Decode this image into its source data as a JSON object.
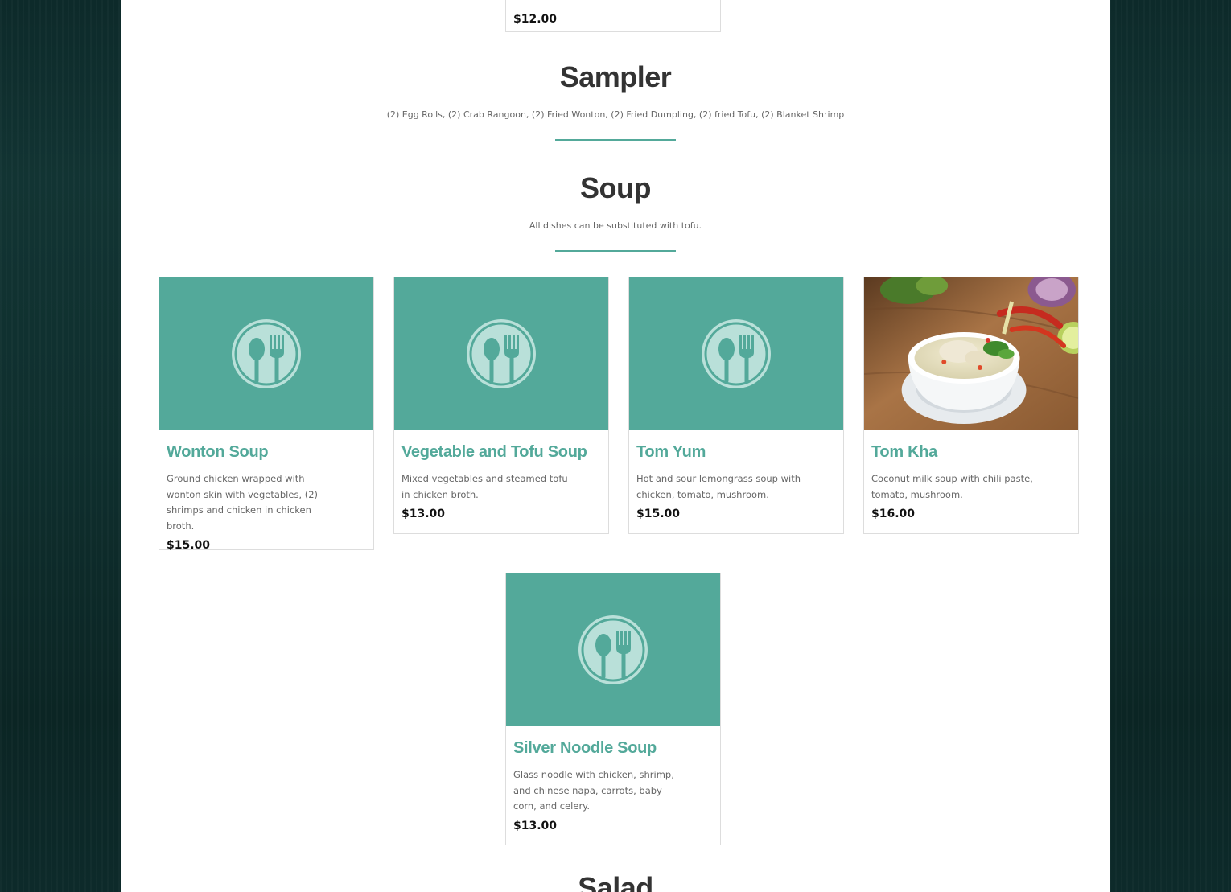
{
  "top_card": {
    "price": "$12.00"
  },
  "sections": {
    "sampler": {
      "title": "Sampler",
      "description": "(2) Egg Rolls, (2) Crab Rangoon, (2) Fried Wonton, (2) Fried Dumpling, (2) fried Tofu, (2) Blanket Shrimp"
    },
    "soup": {
      "title": "Soup",
      "description": "All dishes can be substituted with tofu."
    },
    "salad": {
      "title": "Salad"
    }
  },
  "soups": [
    {
      "name": "Wonton Soup",
      "description": "Ground chicken wrapped with wonton skin with vegetables, (2) shrimps and chicken in chicken broth.",
      "price": "$15.00",
      "image": "utensils-placeholder"
    },
    {
      "name": "Vegetable and Tofu Soup",
      "description": "Mixed vegetables and steamed tofu in chicken broth.",
      "price": "$13.00",
      "image": "utensils-placeholder"
    },
    {
      "name": "Tom Yum",
      "description": "Hot and sour lemongrass soup with chicken, tomato, mushroom.",
      "price": "$15.00",
      "image": "utensils-placeholder"
    },
    {
      "name": "Tom Kha",
      "description": "Coconut milk soup with chili paste, tomato, mushroom.",
      "price": "$16.00",
      "image": "soup-photo"
    },
    {
      "name": "Silver Noodle Soup",
      "description": "Glass noodle with chicken, shrimp, and chinese napa, carrots, baby corn, and celery.",
      "price": "$13.00",
      "image": "utensils-placeholder"
    }
  ],
  "colors": {
    "accent": "#53a99a",
    "background": "#0f2f2e",
    "panel": "#ffffff"
  }
}
